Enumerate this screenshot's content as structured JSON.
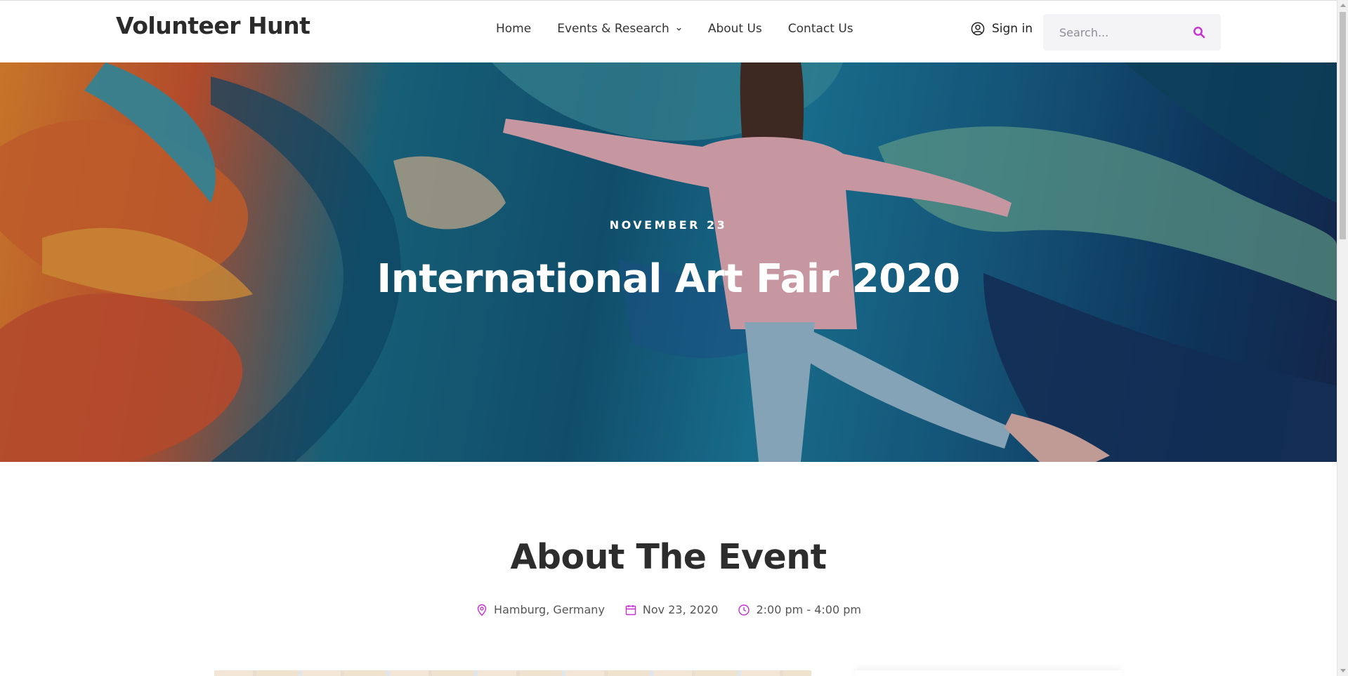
{
  "header": {
    "logo": "Volunteer Hunt",
    "nav": [
      {
        "label": "Home"
      },
      {
        "label": "Events & Research",
        "has_dropdown": true
      },
      {
        "label": "About Us"
      },
      {
        "label": "Contact Us"
      }
    ],
    "signin_label": "Sign in",
    "search": {
      "placeholder": "Search...",
      "value": ""
    }
  },
  "hero": {
    "date": "NOVEMBER 23",
    "title": "International Art Fair 2020"
  },
  "about": {
    "title": "About The Event",
    "location": "Hamburg, Germany",
    "date": "Nov 23, 2020",
    "time": "2:00 pm - 4:00 pm"
  },
  "colors": {
    "accent": "#c72fd6",
    "text_dark": "#2d2d2d",
    "search_bg": "#f4f4f6"
  },
  "icons": {
    "signin": "user-circle-icon",
    "search": "search-icon",
    "location": "map-pin-icon",
    "date": "calendar-icon",
    "time": "clock-icon",
    "dropdown": "chevron-down-icon"
  }
}
